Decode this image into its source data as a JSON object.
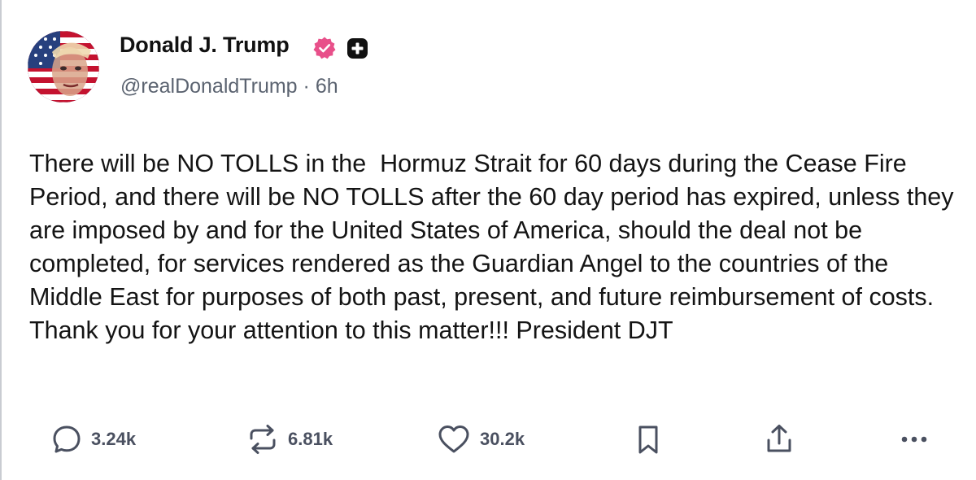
{
  "author": {
    "display_name": "Donald J. Trump",
    "handle": "@realDonaldTrump",
    "separator": "·",
    "time": "6h",
    "verified_badge_color": "#e8508a",
    "avatar_icon": "avatar-image"
  },
  "post": {
    "text": "There will be NO TOLLS in the  Hormuz Strait for 60 days during the Cease Fire Period, and there will be NO TOLLS after the 60 day period has expired, unless they are imposed by and for the United States of America, should the deal not be completed, for services rendered as the Guardian Angel to the countries of the Middle East for purposes of both past, present, and future reimbursement of costs. Thank you for your attention to this matter!!! President DJT"
  },
  "actions": {
    "replies": {
      "icon": "comment-icon",
      "count": "3.24k"
    },
    "reposts": {
      "icon": "repost-icon",
      "count": "6.81k"
    },
    "likes": {
      "icon": "heart-icon",
      "count": "30.2k"
    },
    "bookmark": {
      "icon": "bookmark-icon"
    },
    "share": {
      "icon": "share-icon"
    },
    "more": {
      "icon": "more-icon"
    }
  },
  "colors": {
    "text": "#141414",
    "muted": "#5b6370",
    "icon": "#4a5060"
  }
}
